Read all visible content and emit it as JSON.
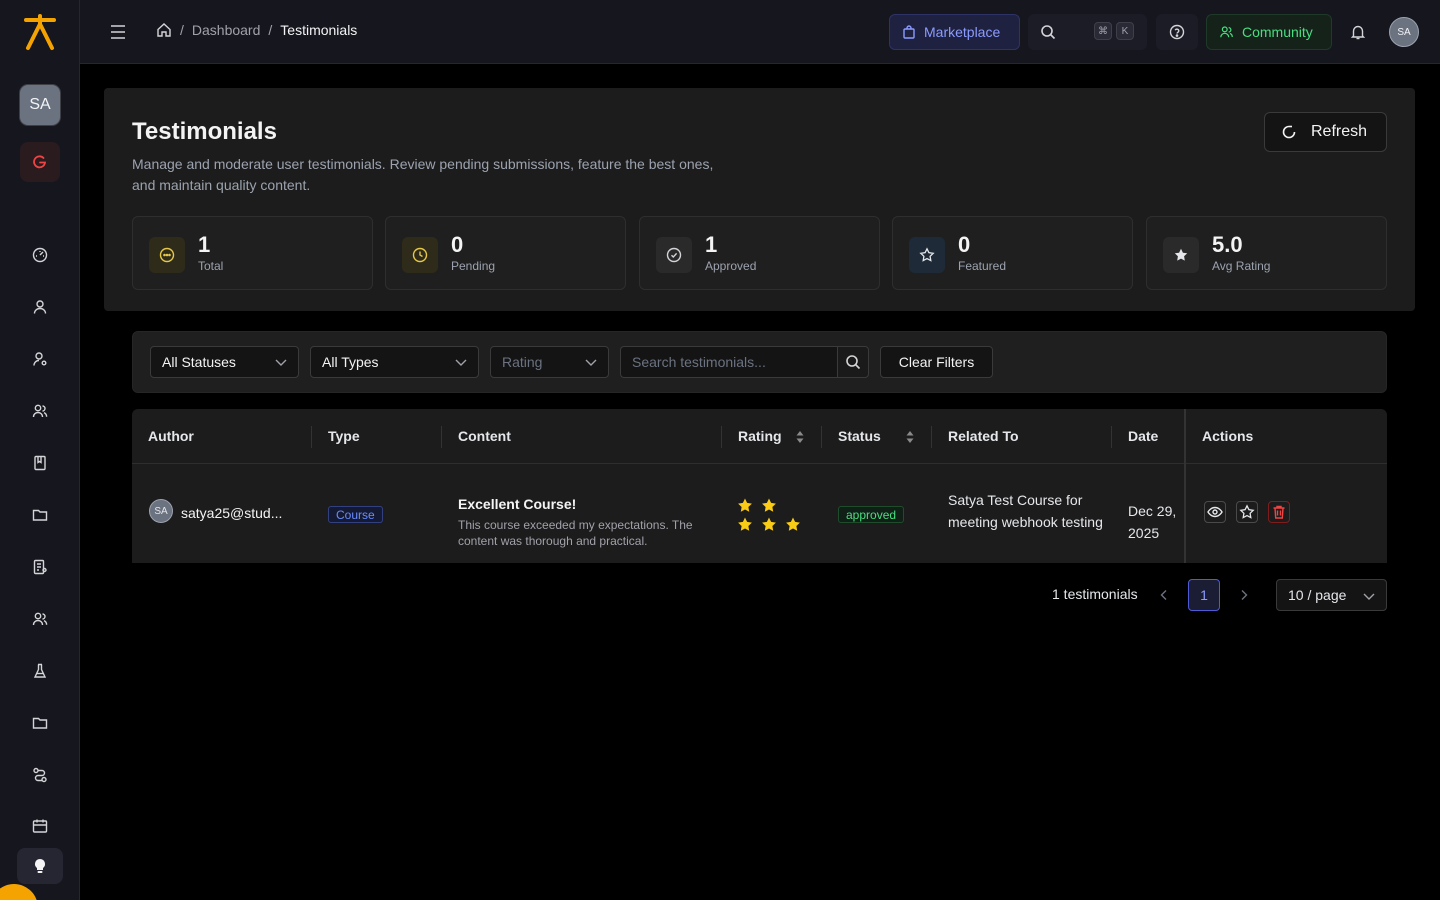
{
  "sidebar": {
    "avatar_initials": "SA",
    "items": [
      {
        "icon": "dashboard-icon"
      },
      {
        "icon": "user-icon"
      },
      {
        "icon": "user-settings-icon"
      },
      {
        "icon": "users-icon"
      },
      {
        "icon": "book-icon"
      },
      {
        "icon": "folder-icon"
      },
      {
        "icon": "document-user-icon"
      },
      {
        "icon": "users-group-icon"
      },
      {
        "icon": "flask-icon"
      },
      {
        "icon": "folder-icon"
      },
      {
        "icon": "route-icon"
      },
      {
        "icon": "calendar-icon"
      }
    ]
  },
  "topbar": {
    "breadcrumb": {
      "separator": "/",
      "parent": "Dashboard",
      "current": "Testimonials"
    },
    "marketplace_label": "Marketplace",
    "kbd_mod": "⌘",
    "kbd_key": "K",
    "community_label": "Community",
    "avatar_initials": "SA"
  },
  "header": {
    "title": "Testimonials",
    "description": "Manage and moderate user testimonials. Review pending submissions, feature the best ones, and maintain quality content.",
    "refresh_label": "Refresh"
  },
  "stats": [
    {
      "value": "1",
      "label": "Total",
      "icon": "chat-bubble-icon"
    },
    {
      "value": "0",
      "label": "Pending",
      "icon": "clock-icon"
    },
    {
      "value": "1",
      "label": "Approved",
      "icon": "check-circle-icon"
    },
    {
      "value": "0",
      "label": "Featured",
      "icon": "star-outline-icon"
    },
    {
      "value": "5.0",
      "label": "Avg Rating",
      "icon": "star-filled-icon"
    }
  ],
  "filters": {
    "status_value": "All Statuses",
    "type_value": "All Types",
    "rating_placeholder": "Rating",
    "search_placeholder": "Search testimonials...",
    "clear_label": "Clear Filters"
  },
  "table": {
    "columns": [
      "Author",
      "Type",
      "Content",
      "Rating",
      "Status",
      "Related To",
      "Date",
      "Actions"
    ],
    "rows": [
      {
        "avatar_initials": "SA",
        "author": "satya25@stud...",
        "type": "Course",
        "content_title": "Excellent Course!",
        "content_body": "This course exceeded my expectations. The content was thorough and practical.",
        "rating": 5,
        "status": "approved",
        "related_to": "Satya Test Course for meeting webhook testing",
        "date": "Dec 29, 2025"
      }
    ]
  },
  "pagination": {
    "total_text": "1 testimonials",
    "current_page": "1",
    "page_size": "10 / page"
  },
  "colors": {
    "brand": "#f5a300",
    "star": "#facc15",
    "approved": "#4ade80",
    "accent": "#8b9cff",
    "danger": "#ef4444"
  }
}
